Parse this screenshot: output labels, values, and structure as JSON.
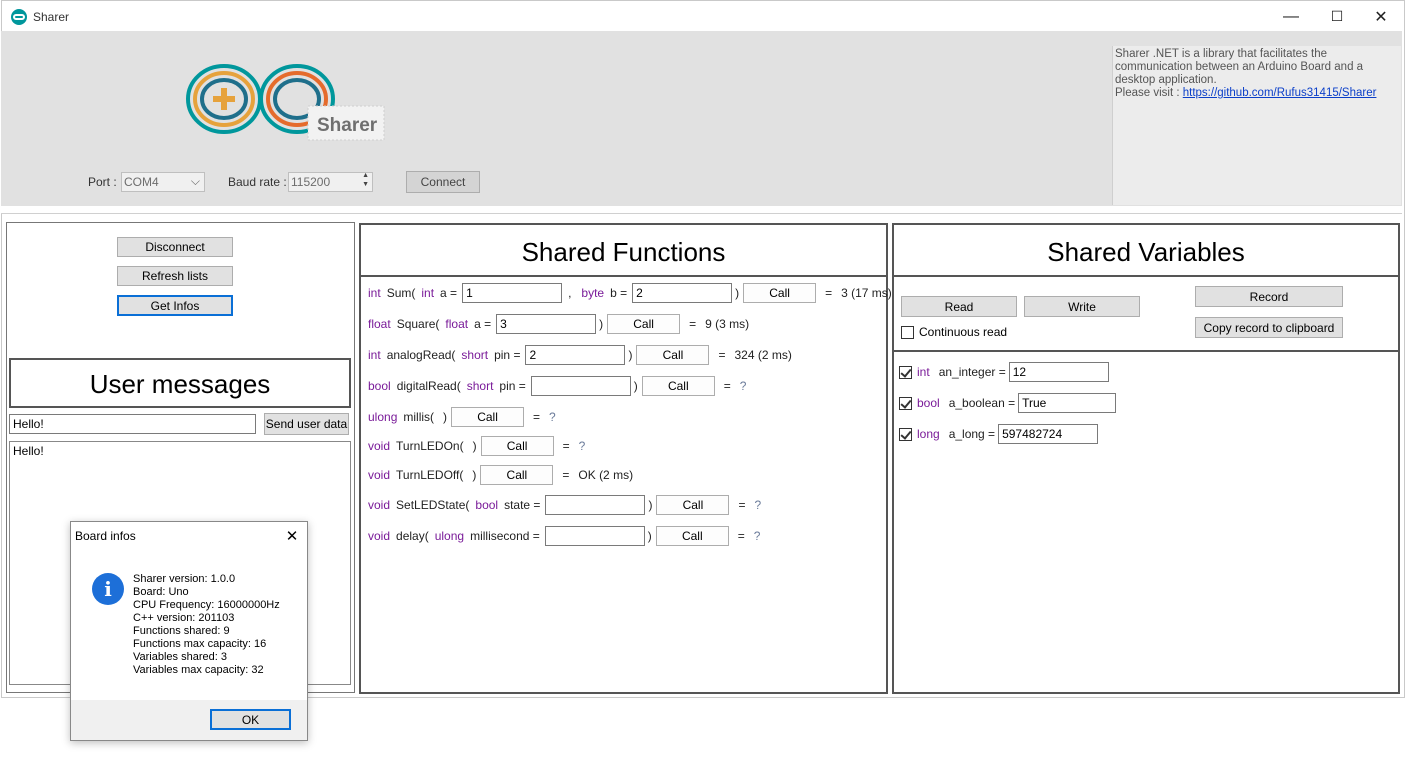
{
  "window": {
    "title": "Sharer",
    "minimize": "—",
    "maximize": "☐",
    "close": "✕"
  },
  "header": {
    "logo_text": "Sharer",
    "port_label": "Port :",
    "port_value": "COM4",
    "baud_label": "Baud rate :",
    "baud_value": "115200",
    "connect_label": "Connect",
    "about_text": "Sharer .NET is a library that facilitates the communication between an Arduino Board and a desktop application.",
    "about_visit": "Please visit : ",
    "about_link": "https://github.com/Rufus31415/Sharer"
  },
  "left_panel": {
    "disconnect_label": "Disconnect",
    "refresh_label": "Refresh lists",
    "get_infos_label": "Get Infos",
    "user_messages_heading": "User messages",
    "message_input_value": "Hello!",
    "send_label": "Send user data",
    "log_text": "Hello!"
  },
  "functions": {
    "heading": "Shared Functions",
    "call_label": "Call",
    "rows": [
      {
        "ret": "int",
        "name": "Sum(",
        "params": [
          {
            "type": "int",
            "name": "a =",
            "value": "1"
          },
          {
            "type": "byte",
            "name": "b =",
            "value": "2"
          }
        ],
        "sep": ",",
        "close": ")",
        "eq": "=",
        "result": "3 (17 ms)"
      },
      {
        "ret": "float",
        "name": "Square(",
        "params": [
          {
            "type": "float",
            "name": "a =",
            "value": "3"
          }
        ],
        "close": ")",
        "eq": "=",
        "result": "9 (3 ms)"
      },
      {
        "ret": "int",
        "name": "analogRead(",
        "params": [
          {
            "type": "short",
            "name": "pin =",
            "value": "2"
          }
        ],
        "close": ")",
        "eq": "=",
        "result": "324 (2 ms)"
      },
      {
        "ret": "bool",
        "name": "digitalRead(",
        "params": [
          {
            "type": "short",
            "name": "pin =",
            "value": ""
          }
        ],
        "close": ")",
        "eq": "=",
        "result": "?"
      },
      {
        "ret": "ulong",
        "name": "millis(",
        "params": [],
        "close": ")",
        "eq": "=",
        "result": "?"
      },
      {
        "ret": "void",
        "name": "TurnLEDOn(",
        "params": [],
        "close": ")",
        "eq": "=",
        "result": "?"
      },
      {
        "ret": "void",
        "name": "TurnLEDOff(",
        "params": [],
        "close": ")",
        "eq": "=",
        "result": "OK (2 ms)"
      },
      {
        "ret": "void",
        "name": "SetLEDState(",
        "params": [
          {
            "type": "bool",
            "name": "state =",
            "value": ""
          }
        ],
        "close": ")",
        "eq": "=",
        "result": "?"
      },
      {
        "ret": "void",
        "name": "delay(",
        "params": [
          {
            "type": "ulong",
            "name": "millisecond =",
            "value": ""
          }
        ],
        "close": ")",
        "eq": "=",
        "result": "?"
      }
    ]
  },
  "variables": {
    "heading": "Shared Variables",
    "read_label": "Read",
    "write_label": "Write",
    "record_label": "Record",
    "copy_label": "Copy record to clipboard",
    "continuous_label": "Continuous read",
    "rows": [
      {
        "type": "int",
        "name": "an_integer =",
        "value": "12"
      },
      {
        "type": "bool",
        "name": "a_boolean =",
        "value": "True"
      },
      {
        "type": "long",
        "name": "a_long =",
        "value": "597482724"
      }
    ]
  },
  "dialog": {
    "title": "Board infos",
    "close": "✕",
    "icon": "info-icon",
    "icon_glyph": "i",
    "lines": [
      "Sharer version: 1.0.0",
      "Board: Uno",
      "CPU Frequency: 16000000Hz",
      "C++ version: 201103",
      "Functions shared: 9",
      "Functions max capacity: 16",
      "Variables shared: 3",
      "Variables max capacity: 32"
    ],
    "ok_label": "OK"
  },
  "colors": {
    "keyword": "#7a1b99",
    "link": "#0b3fc9",
    "info_icon": "#1d6fd8",
    "logo_teal": "#00979c"
  }
}
